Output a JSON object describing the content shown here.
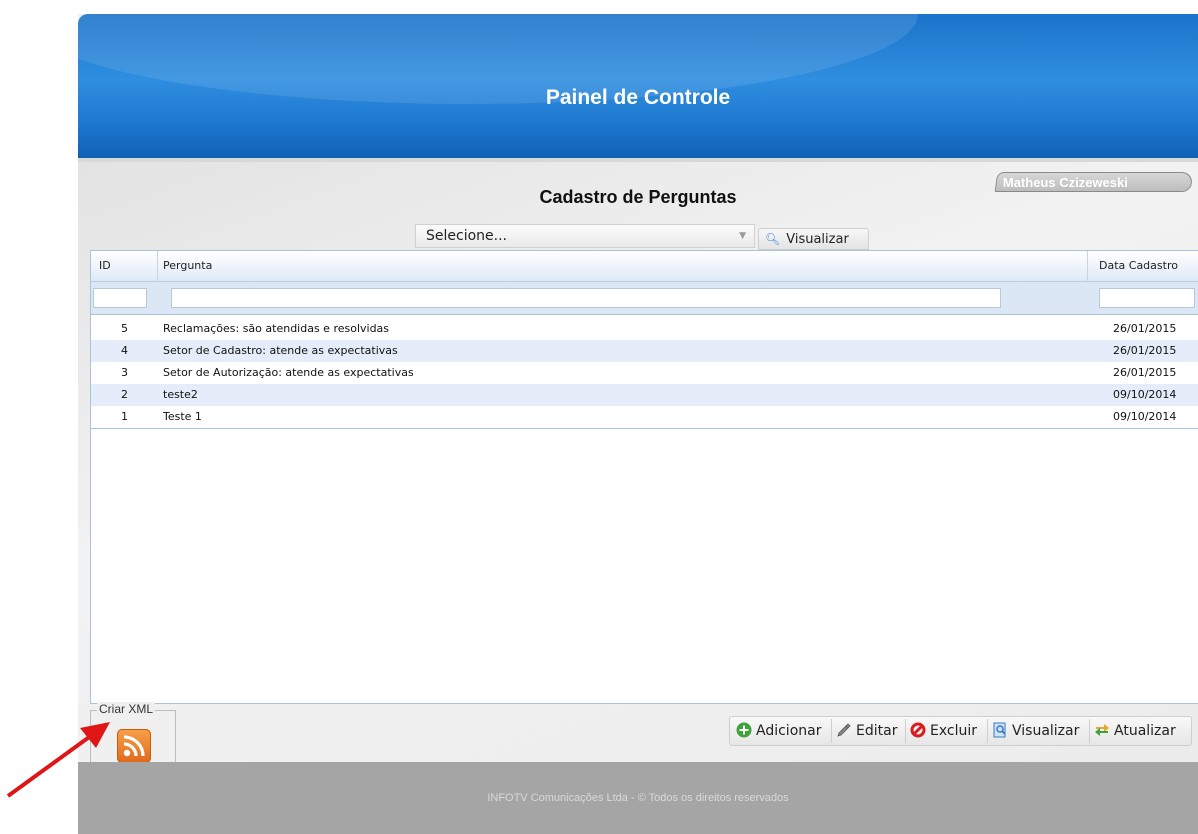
{
  "header": {
    "title": "Painel de Controle"
  },
  "user": {
    "name": "Matheus Czizeweski"
  },
  "page": {
    "title": "Cadastro de Perguntas"
  },
  "filter": {
    "select_value": "Selecione...",
    "visualizar_label": "Visualizar"
  },
  "grid": {
    "columns": [
      "ID",
      "Pergunta",
      "Data Cadastro"
    ],
    "rows": [
      {
        "id": "5",
        "pergunta": "Reclamações: são atendidas e resolvidas",
        "data": "26/01/2015"
      },
      {
        "id": "4",
        "pergunta": "Setor de Cadastro: atende as expectativas",
        "data": "26/01/2015"
      },
      {
        "id": "3",
        "pergunta": "Setor de Autorização: atende as expectativas",
        "data": "26/01/2015"
      },
      {
        "id": "2",
        "pergunta": "teste2",
        "data": "09/10/2014"
      },
      {
        "id": "1",
        "pergunta": "Teste 1",
        "data": "09/10/2014"
      }
    ]
  },
  "xml": {
    "legend": "Criar XML",
    "icon": "rss-icon"
  },
  "toolbar": {
    "adicionar": "Adicionar",
    "editar": "Editar",
    "excluir": "Excluir",
    "visualizar": "Visualizar",
    "atualizar": "Atualizar"
  },
  "footer": {
    "text": "INFOTV Comunicações Ltda - © Todos os direitos reservados"
  },
  "colors": {
    "header_blue": "#1e78cf",
    "row_alt": "#e4edf9",
    "footer_gray": "#a5a5a5",
    "annotation_arrow": "#e01515"
  }
}
